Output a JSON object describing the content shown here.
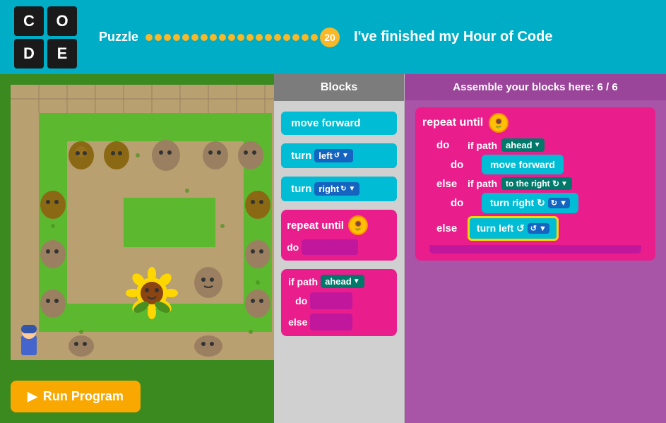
{
  "header": {
    "logo": {
      "cells": [
        "C",
        "O",
        "D",
        "E"
      ]
    },
    "puzzle_label": "Puzzle",
    "puzzle_number": "20",
    "finished_text": "I've finished my Hour of Code",
    "dots_count": 20
  },
  "blocks_panel": {
    "header": "Blocks",
    "items": [
      {
        "id": "move-forward",
        "label": "move forward",
        "type": "cyan"
      },
      {
        "id": "turn-left",
        "label": "turn",
        "dropdown": "left",
        "symbol": "↺",
        "type": "cyan"
      },
      {
        "id": "turn-right",
        "label": "turn",
        "dropdown": "right",
        "symbol": "↻",
        "type": "cyan"
      },
      {
        "id": "repeat-until",
        "label": "repeat until",
        "type": "pink"
      },
      {
        "id": "if-path",
        "label": "if path",
        "dropdown": "ahead",
        "type": "pink"
      }
    ]
  },
  "assemble_panel": {
    "header": "Assemble your blocks here: 6 / 6",
    "repeat_label": "repeat until",
    "do_label": "do",
    "else_label": "else",
    "if_path_label": "if path",
    "ahead_dropdown": "ahead",
    "to_the_right_dropdown": "to the right ↻",
    "move_forward_label": "move forward",
    "turn_right_label": "turn right ↻",
    "turn_left_label": "turn left ↺"
  },
  "run_button": {
    "label": "Run Program"
  }
}
